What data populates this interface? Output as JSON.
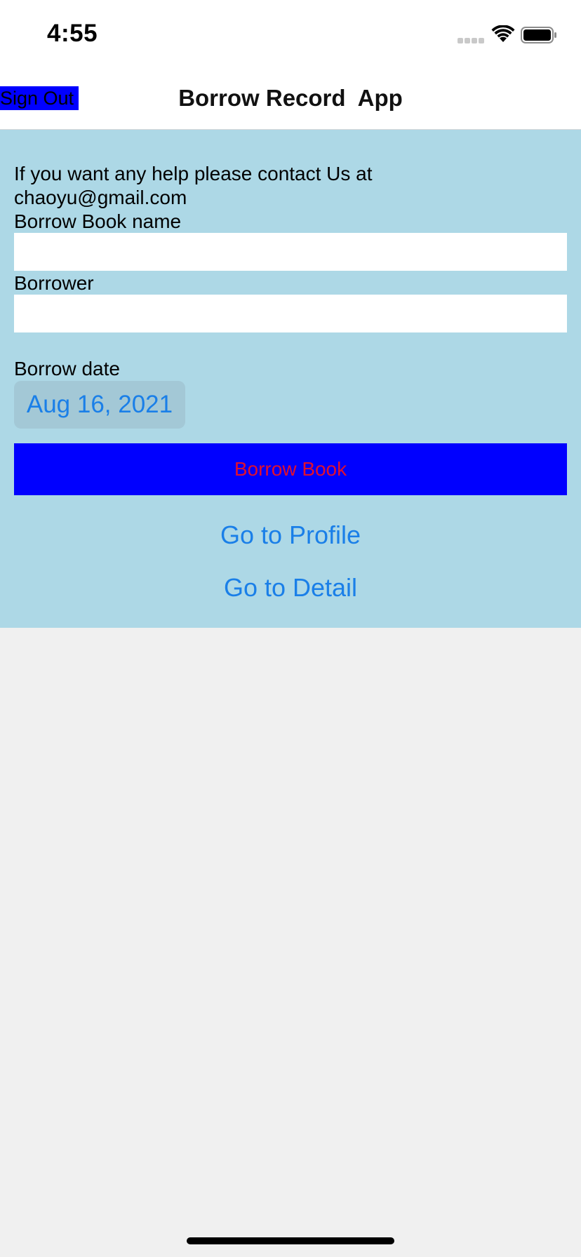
{
  "status_bar": {
    "time": "4:55",
    "icons": [
      "signal-icon",
      "wifi-icon",
      "battery-icon"
    ]
  },
  "nav": {
    "title": "Borrow Record  App",
    "sign_out_label": "Sign Out"
  },
  "form": {
    "help_text": "If you want any help please contact Us at chaoyu@gmail.com",
    "book_name_label": "Borrow Book name",
    "book_name_value": "",
    "borrower_label": "Borrower",
    "borrower_value": "",
    "borrow_date_label": "Borrow date",
    "borrow_date_value": "Aug 16, 2021",
    "borrow_button_label": "Borrow Book",
    "profile_link_label": "Go to Profile",
    "detail_link_label": "Go to Detail"
  },
  "colors": {
    "panel_background": "#add8e6",
    "page_background": "#f0f0f0",
    "sign_out_background": "#0000ff",
    "borrow_button_background": "#0000ff",
    "borrow_button_text": "#e0102f",
    "link_text": "#1a7fe8"
  }
}
